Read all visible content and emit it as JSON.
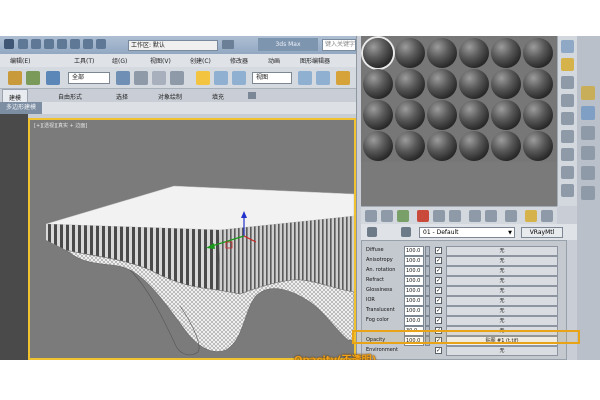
{
  "window": {
    "workspace_label": "工作区: 默认",
    "title": "3ds Max",
    "search_placeholder": "键入关键字"
  },
  "menu": [
    "编辑(E)",
    "工具(T)",
    "组(G)",
    "视图(V)",
    "创建(C)",
    "修改器",
    "动画",
    "图形编辑器"
  ],
  "toolbar": {
    "selection_filter": "全部",
    "reference_coord": "视图"
  },
  "ribbon": {
    "tabs": [
      "建模",
      "自由形式",
      "选择",
      "对象绘制",
      "填充"
    ],
    "active_tab": "建模",
    "sub_label": "多边形建模"
  },
  "viewport": {
    "label": "[+][透视][真实 + 边面]"
  },
  "material_editor": {
    "material_name": "01 - Default",
    "material_type": "VRayMtl",
    "params": [
      {
        "label": "Diffuse",
        "value": "100.0",
        "checked": true,
        "map": "无"
      },
      {
        "label": "Anisotropy",
        "value": "100.0",
        "checked": true,
        "map": "无"
      },
      {
        "label": "An. rotation",
        "value": "100.0",
        "checked": true,
        "map": "无"
      },
      {
        "label": "Refract",
        "value": "100.0",
        "checked": true,
        "map": "无"
      },
      {
        "label": "Glossiness",
        "value": "100.0",
        "checked": true,
        "map": "无"
      },
      {
        "label": "IOR",
        "value": "100.0",
        "checked": true,
        "map": "无"
      },
      {
        "label": "Translucent",
        "value": "100.0",
        "checked": true,
        "map": "无"
      },
      {
        "label": "Fog color",
        "value": "100.0",
        "checked": true,
        "map": "无"
      },
      {
        "label": "",
        "value": "30.0",
        "checked": true,
        "map": "无"
      },
      {
        "label": "Opacity",
        "value": "100.0",
        "checked": true,
        "map": "贴图 #1 (t.tif)"
      },
      {
        "label": "Environment",
        "value": "",
        "checked": true,
        "map": "无"
      }
    ]
  },
  "caption": "Opacity(不透明)",
  "colors": {
    "accent": "#e8a317",
    "viewport_border": "#f0c230",
    "viewport_bg": "#7b7b7b"
  }
}
